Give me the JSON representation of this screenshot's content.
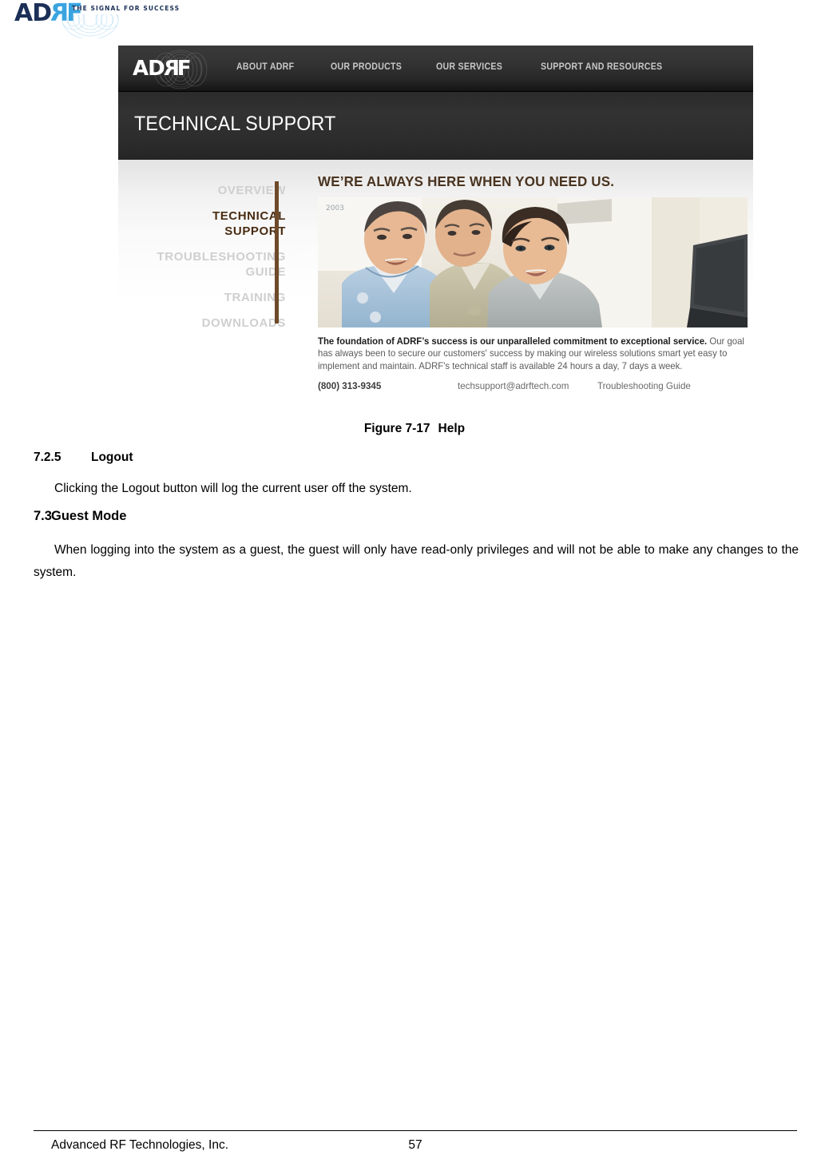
{
  "letterhead": {
    "logo_ad": "AD",
    "logo_r": "R",
    "logo_f": "F",
    "tagline": "THE SIGNAL FOR SUCCESS",
    "navy": "#1b2f57",
    "blue": "#3aa4e0"
  },
  "figure": {
    "site": {
      "logo_ad": "AD",
      "logo_r": "R",
      "logo_f": "F",
      "nav": [
        "ABOUT ADRF",
        "OUR PRODUCTS",
        "OUR SERVICES",
        "SUPPORT AND RESOURCES"
      ],
      "page_title": "TECHNICAL SUPPORT",
      "side_menu": [
        "OVERVIEW",
        "TECHNICAL\nSUPPORT",
        "TROUBLESHOOTING\nGUIDE",
        "TRAINING",
        "DOWNLOADS"
      ],
      "side_menu_active_index": 1,
      "accent_brown": "#6e4a2a",
      "headline": "WE’RE ALWAYS HERE WHEN YOU NEED US.",
      "blurb_bold": "The foundation of ADRF’s success is our unparalleled commitment to exceptional service.",
      "blurb_rest": " Our goal has always been to secure our customers' success by making our wireless solutions smart yet easy to implement and maintain. ADRF's technical staff is available 24 hours a day, 7 days a week.",
      "phone": "(800) 313-9345",
      "email": "techsupport@adrftech.com",
      "link": "Troubleshooting Guide"
    }
  },
  "document": {
    "figure_caption_number": "Figure 7-17",
    "figure_caption_title": "Help",
    "heading_725_num": "7.2.5",
    "heading_725_title": "Logout",
    "para_logout": "Clicking the Logout button will log the current user off the system.",
    "heading_73_num": "7.3",
    "heading_73_title": "Guest Mode",
    "para_guest": "When logging into the system as a guest, the guest will only have read-only privileges and will not be able to make any changes to the system."
  },
  "footer": {
    "company": "Advanced RF Technologies, Inc.",
    "page_number": "57"
  }
}
